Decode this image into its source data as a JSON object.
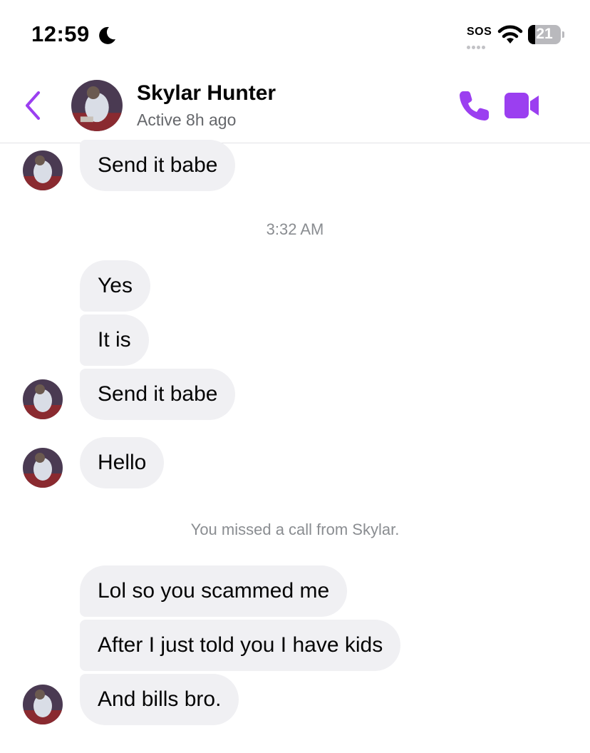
{
  "status_bar": {
    "time": "12:59",
    "sos": "SOS",
    "battery": "21",
    "battery_level_percent": 21,
    "icons": [
      "moon-icon",
      "wifi-icon",
      "battery-icon"
    ]
  },
  "header": {
    "contact_name": "Skylar Hunter",
    "contact_status": "Active 8h ago",
    "icons": [
      "back-chevron-icon",
      "phone-icon",
      "video-camera-icon"
    ],
    "accent_color": "#9b3ff0"
  },
  "conversation": {
    "timestamp": "3:32 AM",
    "system_message": "You missed a call from Skylar.",
    "bubble_color": "#f0f0f3",
    "messages": [
      {
        "text": "Send it babe"
      },
      {
        "text": "Yes"
      },
      {
        "text": "It is"
      },
      {
        "text": "Send it babe"
      },
      {
        "text": "Hello"
      },
      {
        "text": "Lol so you scammed me"
      },
      {
        "text": "After I just told you I have kids"
      },
      {
        "text": "And bills bro."
      }
    ]
  }
}
